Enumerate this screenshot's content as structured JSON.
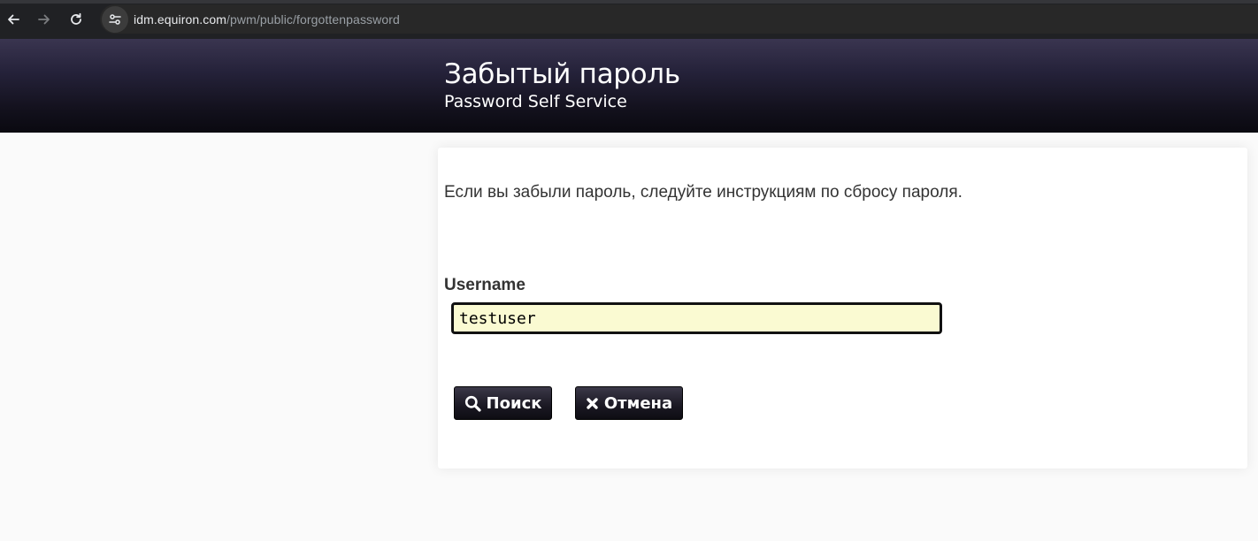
{
  "browser": {
    "url_domain": "idm.equiron.com",
    "url_path": "/pwm/public/forgottenpassword"
  },
  "header": {
    "title": "Забытый пароль",
    "subtitle": "Password Self Service"
  },
  "form": {
    "instructions": "Если вы забыли пароль, следуйте инструкциям по сбросу пароля.",
    "username_label": "Username",
    "username_value": "testuser",
    "search_label": "Поиск",
    "cancel_label": "Отмена"
  },
  "icons": {
    "back": "arrow-left-icon",
    "forward": "arrow-right-icon",
    "reload": "reload-icon",
    "site_info": "tune-icon",
    "search": "search-icon",
    "cancel": "close-icon"
  },
  "colors": {
    "header_top": "#3a3550",
    "header_bottom": "#0a0910",
    "input_bg": "#fafad2",
    "button_bg": "#1a1822"
  }
}
